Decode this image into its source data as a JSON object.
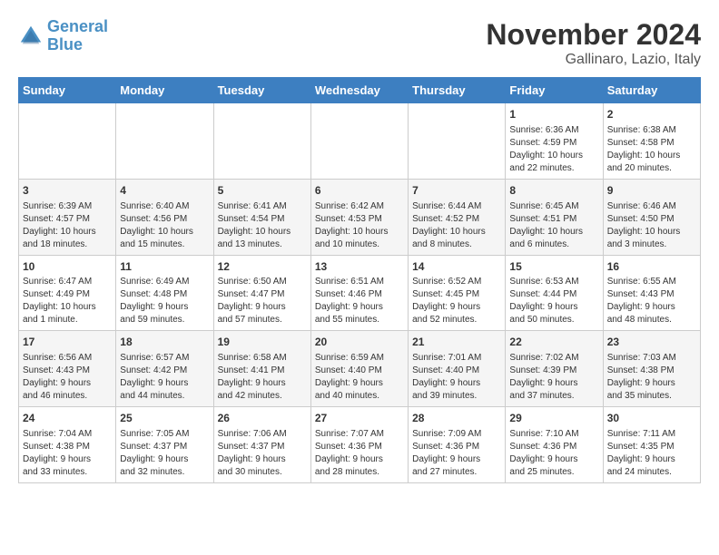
{
  "header": {
    "logo_line1": "General",
    "logo_line2": "Blue",
    "month_title": "November 2024",
    "location": "Gallinaro, Lazio, Italy"
  },
  "weekdays": [
    "Sunday",
    "Monday",
    "Tuesday",
    "Wednesday",
    "Thursday",
    "Friday",
    "Saturday"
  ],
  "weeks": [
    [
      {
        "day": "",
        "info": ""
      },
      {
        "day": "",
        "info": ""
      },
      {
        "day": "",
        "info": ""
      },
      {
        "day": "",
        "info": ""
      },
      {
        "day": "",
        "info": ""
      },
      {
        "day": "1",
        "info": "Sunrise: 6:36 AM\nSunset: 4:59 PM\nDaylight: 10 hours\nand 22 minutes."
      },
      {
        "day": "2",
        "info": "Sunrise: 6:38 AM\nSunset: 4:58 PM\nDaylight: 10 hours\nand 20 minutes."
      }
    ],
    [
      {
        "day": "3",
        "info": "Sunrise: 6:39 AM\nSunset: 4:57 PM\nDaylight: 10 hours\nand 18 minutes."
      },
      {
        "day": "4",
        "info": "Sunrise: 6:40 AM\nSunset: 4:56 PM\nDaylight: 10 hours\nand 15 minutes."
      },
      {
        "day": "5",
        "info": "Sunrise: 6:41 AM\nSunset: 4:54 PM\nDaylight: 10 hours\nand 13 minutes."
      },
      {
        "day": "6",
        "info": "Sunrise: 6:42 AM\nSunset: 4:53 PM\nDaylight: 10 hours\nand 10 minutes."
      },
      {
        "day": "7",
        "info": "Sunrise: 6:44 AM\nSunset: 4:52 PM\nDaylight: 10 hours\nand 8 minutes."
      },
      {
        "day": "8",
        "info": "Sunrise: 6:45 AM\nSunset: 4:51 PM\nDaylight: 10 hours\nand 6 minutes."
      },
      {
        "day": "9",
        "info": "Sunrise: 6:46 AM\nSunset: 4:50 PM\nDaylight: 10 hours\nand 3 minutes."
      }
    ],
    [
      {
        "day": "10",
        "info": "Sunrise: 6:47 AM\nSunset: 4:49 PM\nDaylight: 10 hours\nand 1 minute."
      },
      {
        "day": "11",
        "info": "Sunrise: 6:49 AM\nSunset: 4:48 PM\nDaylight: 9 hours\nand 59 minutes."
      },
      {
        "day": "12",
        "info": "Sunrise: 6:50 AM\nSunset: 4:47 PM\nDaylight: 9 hours\nand 57 minutes."
      },
      {
        "day": "13",
        "info": "Sunrise: 6:51 AM\nSunset: 4:46 PM\nDaylight: 9 hours\nand 55 minutes."
      },
      {
        "day": "14",
        "info": "Sunrise: 6:52 AM\nSunset: 4:45 PM\nDaylight: 9 hours\nand 52 minutes."
      },
      {
        "day": "15",
        "info": "Sunrise: 6:53 AM\nSunset: 4:44 PM\nDaylight: 9 hours\nand 50 minutes."
      },
      {
        "day": "16",
        "info": "Sunrise: 6:55 AM\nSunset: 4:43 PM\nDaylight: 9 hours\nand 48 minutes."
      }
    ],
    [
      {
        "day": "17",
        "info": "Sunrise: 6:56 AM\nSunset: 4:43 PM\nDaylight: 9 hours\nand 46 minutes."
      },
      {
        "day": "18",
        "info": "Sunrise: 6:57 AM\nSunset: 4:42 PM\nDaylight: 9 hours\nand 44 minutes."
      },
      {
        "day": "19",
        "info": "Sunrise: 6:58 AM\nSunset: 4:41 PM\nDaylight: 9 hours\nand 42 minutes."
      },
      {
        "day": "20",
        "info": "Sunrise: 6:59 AM\nSunset: 4:40 PM\nDaylight: 9 hours\nand 40 minutes."
      },
      {
        "day": "21",
        "info": "Sunrise: 7:01 AM\nSunset: 4:40 PM\nDaylight: 9 hours\nand 39 minutes."
      },
      {
        "day": "22",
        "info": "Sunrise: 7:02 AM\nSunset: 4:39 PM\nDaylight: 9 hours\nand 37 minutes."
      },
      {
        "day": "23",
        "info": "Sunrise: 7:03 AM\nSunset: 4:38 PM\nDaylight: 9 hours\nand 35 minutes."
      }
    ],
    [
      {
        "day": "24",
        "info": "Sunrise: 7:04 AM\nSunset: 4:38 PM\nDaylight: 9 hours\nand 33 minutes."
      },
      {
        "day": "25",
        "info": "Sunrise: 7:05 AM\nSunset: 4:37 PM\nDaylight: 9 hours\nand 32 minutes."
      },
      {
        "day": "26",
        "info": "Sunrise: 7:06 AM\nSunset: 4:37 PM\nDaylight: 9 hours\nand 30 minutes."
      },
      {
        "day": "27",
        "info": "Sunrise: 7:07 AM\nSunset: 4:36 PM\nDaylight: 9 hours\nand 28 minutes."
      },
      {
        "day": "28",
        "info": "Sunrise: 7:09 AM\nSunset: 4:36 PM\nDaylight: 9 hours\nand 27 minutes."
      },
      {
        "day": "29",
        "info": "Sunrise: 7:10 AM\nSunset: 4:36 PM\nDaylight: 9 hours\nand 25 minutes."
      },
      {
        "day": "30",
        "info": "Sunrise: 7:11 AM\nSunset: 4:35 PM\nDaylight: 9 hours\nand 24 minutes."
      }
    ]
  ]
}
